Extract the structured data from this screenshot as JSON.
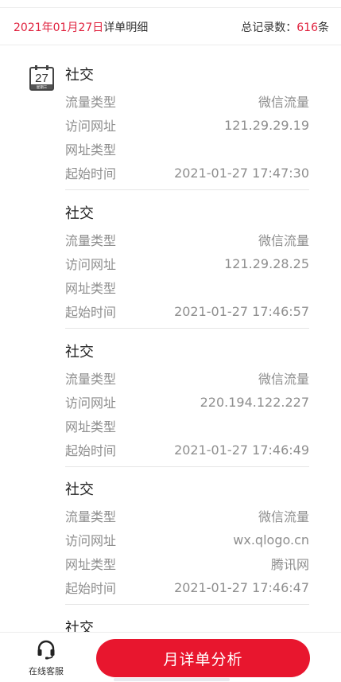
{
  "header": {
    "date": "2021年01月27日",
    "suffix": "详单明细",
    "total_label": "总记录数：",
    "total_count": "616",
    "total_unit": "条"
  },
  "calendar_icon": {
    "day": "27",
    "weekday": "星期三"
  },
  "labels": {
    "traffic_type": "流量类型",
    "url": "访问网址",
    "url_type": "网址类型",
    "start_time": "起始时间"
  },
  "records": [
    {
      "category": "社交",
      "traffic_type": "微信流量",
      "url": "121.29.29.19",
      "url_type": "",
      "start_time": "2021-01-27 17:47:30"
    },
    {
      "category": "社交",
      "traffic_type": "微信流量",
      "url": "121.29.28.25",
      "url_type": "",
      "start_time": "2021-01-27 17:46:57"
    },
    {
      "category": "社交",
      "traffic_type": "微信流量",
      "url": "220.194.122.227",
      "url_type": "",
      "start_time": "2021-01-27 17:46:49"
    },
    {
      "category": "社交",
      "traffic_type": "微信流量",
      "url": "wx.qlogo.cn",
      "url_type": "腾讯网",
      "start_time": "2021-01-27 17:46:47"
    },
    {
      "category": "社交"
    }
  ],
  "bottom": {
    "service_label": "在线客服",
    "analyze_button": "月详单分析"
  },
  "colors": {
    "accent": "#e8162e",
    "header_red": "#e0233f"
  }
}
